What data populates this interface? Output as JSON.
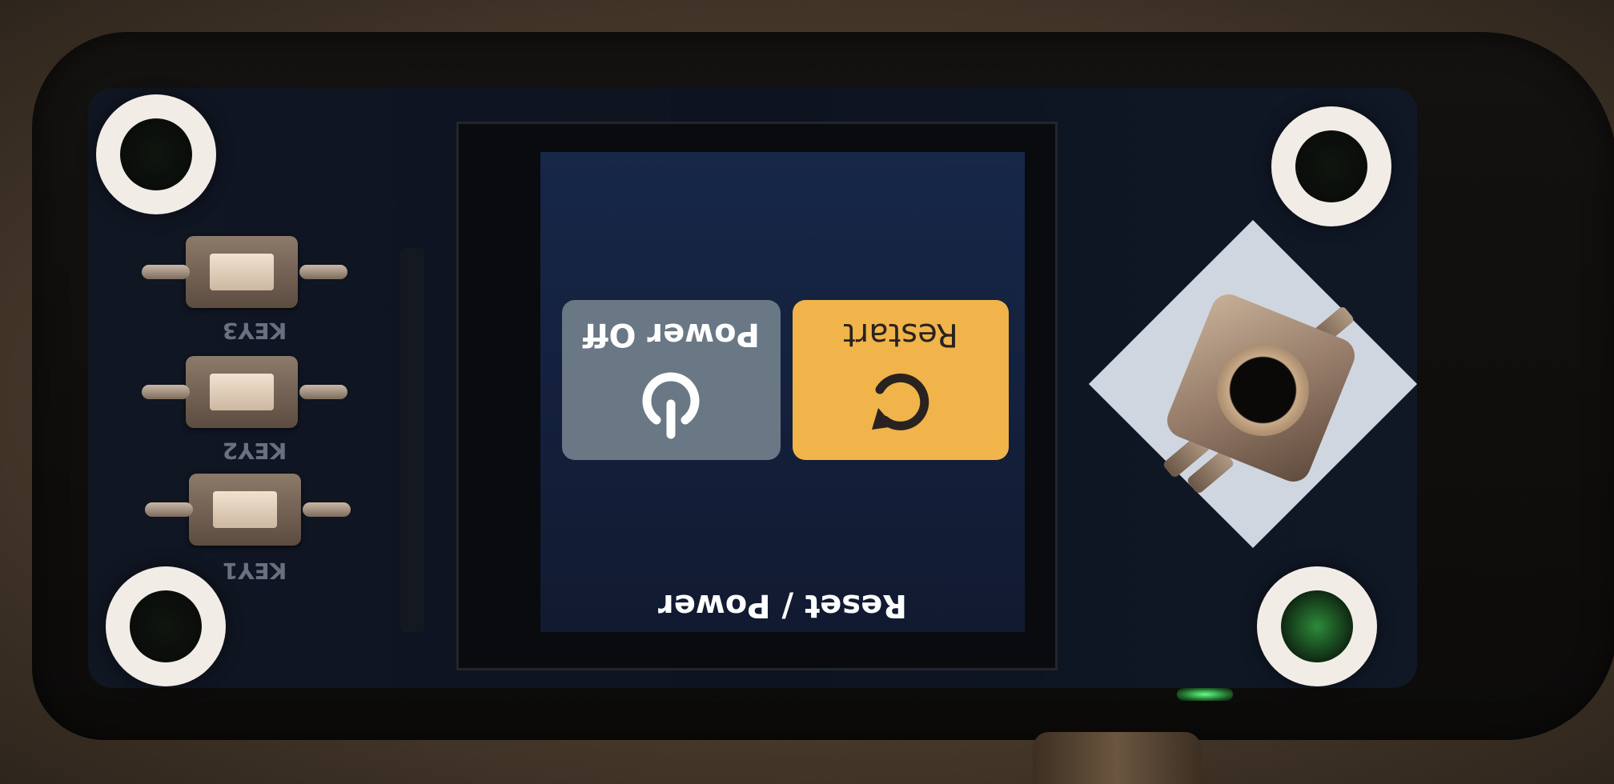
{
  "screen": {
    "title": "Reset / Power",
    "tiles": [
      {
        "label": "Restart",
        "icon": "restart-icon",
        "color": "#f0b44a",
        "selected": true
      },
      {
        "label": "Power Off",
        "icon": "power-icon",
        "color": "#6a7785",
        "selected": false
      }
    ]
  },
  "keys": [
    {
      "label": "KEY3"
    },
    {
      "label": "KEY2"
    },
    {
      "label": "KEY1"
    }
  ],
  "device_colors": {
    "screen_background": "#172748",
    "bezel": "#141210",
    "status_led": "#66ff88"
  }
}
